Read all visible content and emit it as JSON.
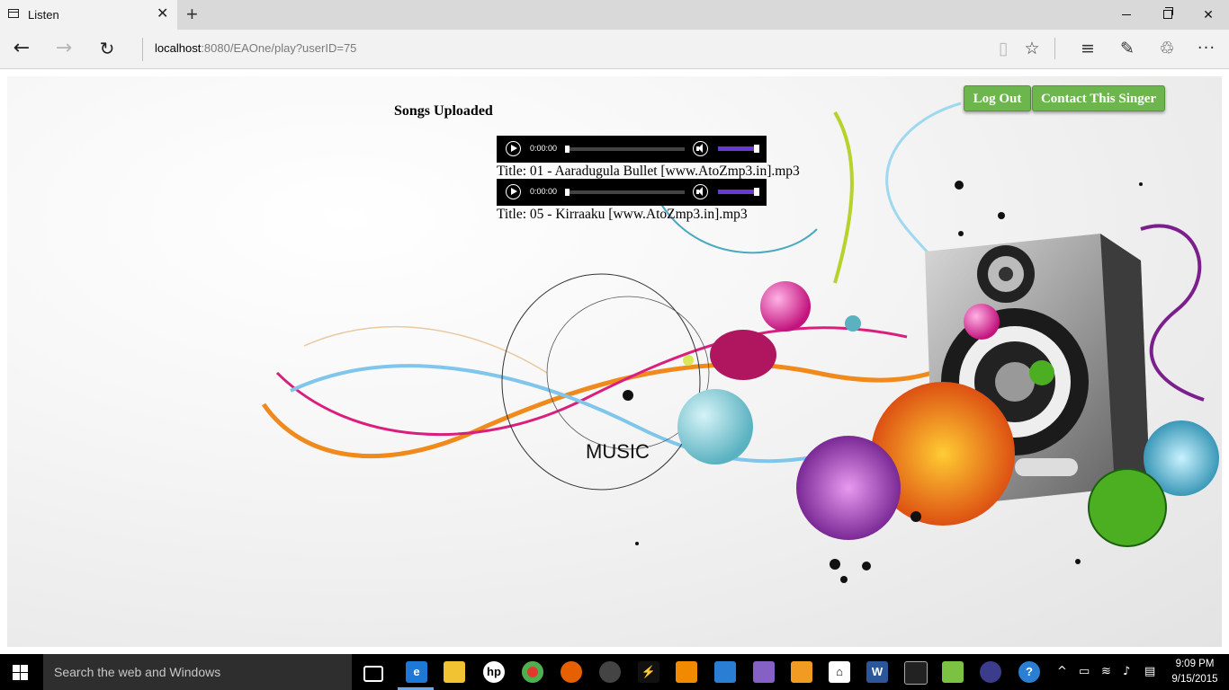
{
  "browser": {
    "tab_title": "Listen",
    "tab_close": "✕",
    "new_tab": "+",
    "address_host": "localhost",
    "address_rest": ":8080/EAOne/play?userID=75",
    "icons": [
      "tab-page-icon",
      "back-icon",
      "forward-icon",
      "refresh-icon",
      "reading-view-icon",
      "favorite-star-icon",
      "hub-icon",
      "web-note-icon",
      "share-icon",
      "more-icon",
      "minimize-icon",
      "maximize-icon",
      "close-icon"
    ]
  },
  "page": {
    "heading": "Songs Uploaded",
    "logout_label": "Log Out",
    "contact_label": "Contact This Singer",
    "button_color": "#6db64e",
    "background_art_text": "MUSIC",
    "songs": [
      {
        "time": "0:00:00",
        "title": "Title: 01 - Aaradugula Bullet [www.AtoZmp3.in].mp3"
      },
      {
        "time": "0:00:00",
        "title": "Title: 05 - Kirraaku [www.AtoZmp3.in].mp3"
      }
    ]
  },
  "taskbar": {
    "search_placeholder": "Search the web and Windows",
    "clock_time": "9:09 PM",
    "clock_date": "9/15/2015",
    "apps": [
      "task-view-icon",
      "edge-icon",
      "file-explorer-icon",
      "hp-icon",
      "chrome-icon",
      "firefox-icon",
      "media-icon",
      "winamp-icon",
      "vlc-icon",
      "photos-icon",
      "visual-studio-icon",
      "store-lock-icon",
      "home-icon",
      "word-icon",
      "cmd-icon",
      "notepadpp-icon",
      "eclipse-icon",
      "help-icon"
    ]
  }
}
